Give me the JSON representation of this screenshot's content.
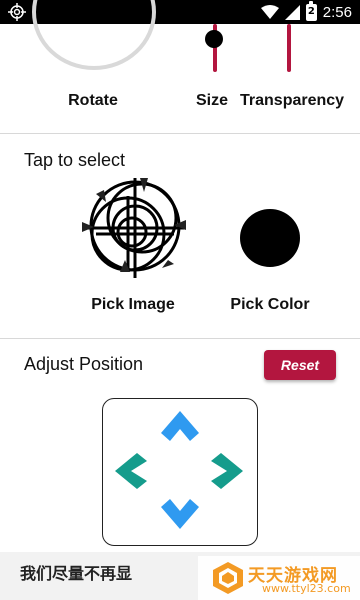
{
  "statusbar": {
    "time": "2:56",
    "battery": "2",
    "icons": [
      "crosshair-icon",
      "wifi-icon",
      "signal-icon",
      "battery-icon"
    ]
  },
  "controls": {
    "rotate_label": "Rotate",
    "size_label": "Size",
    "transparency_label": "Transparency",
    "size_value": 0.2,
    "transparency_value": 0.0
  },
  "select": {
    "title": "Tap to select",
    "pick_image_label": "Pick Image",
    "pick_color_label": "Pick Color",
    "selected_color": "#000000"
  },
  "position": {
    "title": "Adjust Position",
    "reset_label": "Reset"
  },
  "banner": {
    "text": "我们尽量不再显"
  },
  "watermark": {
    "title": "天天游戏网",
    "url": "www.ttyl23.com"
  },
  "colors": {
    "accent": "#b3163f",
    "arrow_blue": "#2f9af0",
    "arrow_teal": "#159c8c"
  }
}
